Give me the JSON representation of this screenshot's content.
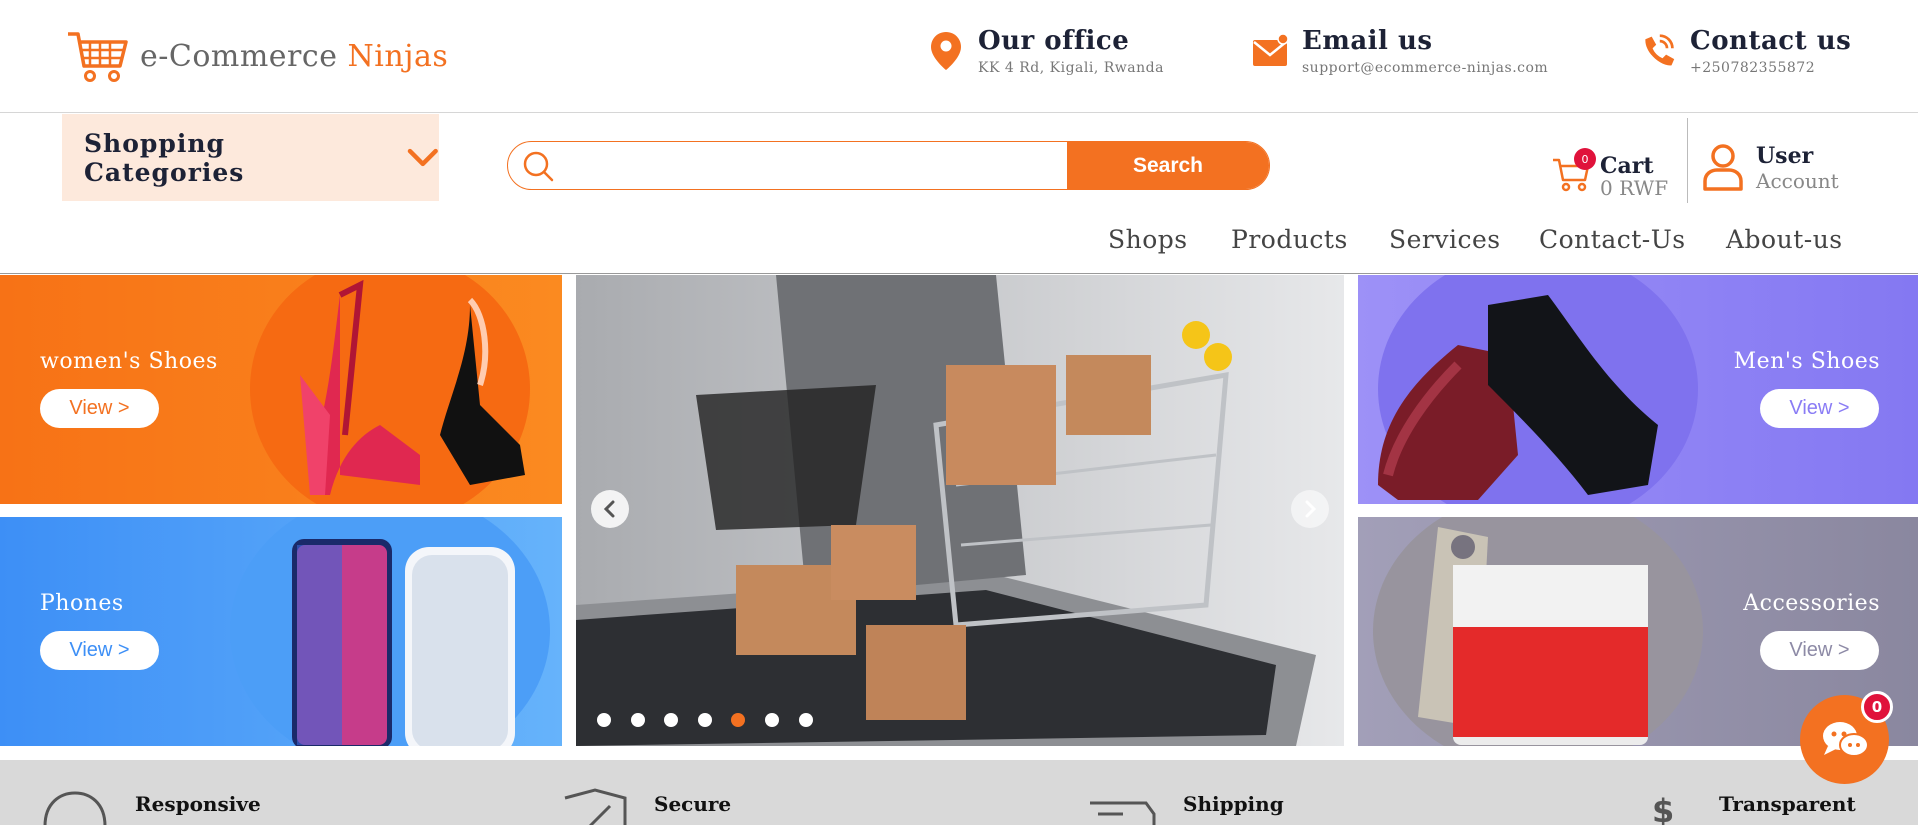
{
  "header": {
    "logo": {
      "text_main": "e-Commerce",
      "text_accent": "Ninjas"
    },
    "office": {
      "title": "Our office",
      "detail": "KK 4 Rd, Kigali, Rwanda"
    },
    "email": {
      "title": "Email us",
      "detail": "support@ecommerce-ninjas.com"
    },
    "contact": {
      "title": "Contact us",
      "detail": "+250782355872"
    }
  },
  "toolbar": {
    "categories_label": "Shopping Categories",
    "search": {
      "placeholder": "",
      "value": "",
      "button_label": "Search"
    },
    "cart": {
      "label": "Cart",
      "amount": "0 RWF",
      "count": "0"
    },
    "user": {
      "label": "User",
      "sub": "Account"
    }
  },
  "nav": [
    "Shops",
    "Products",
    "Services",
    "Contact-Us",
    "About-us"
  ],
  "tiles": {
    "womens_shoes": {
      "label": "women's Shoes",
      "button": "View >"
    },
    "phones": {
      "label": "Phones",
      "button": "View >"
    },
    "mens_shoes": {
      "label": "Men's Shoes",
      "button": "View >"
    },
    "accessories": {
      "label": "Accessories",
      "button": "View >"
    }
  },
  "slider": {
    "dot_count": 7,
    "active_dot": 5
  },
  "features": [
    "Responsive",
    "Secure",
    "Shipping",
    "Transparent"
  ],
  "chat": {
    "badge": "0"
  },
  "colors": {
    "accent": "#f37121",
    "dark": "#1d2236",
    "badge": "#e0123b",
    "blue": "#4d9ff5",
    "purple": "#8a7cf5",
    "grey_purple": "#8d8aa6"
  }
}
